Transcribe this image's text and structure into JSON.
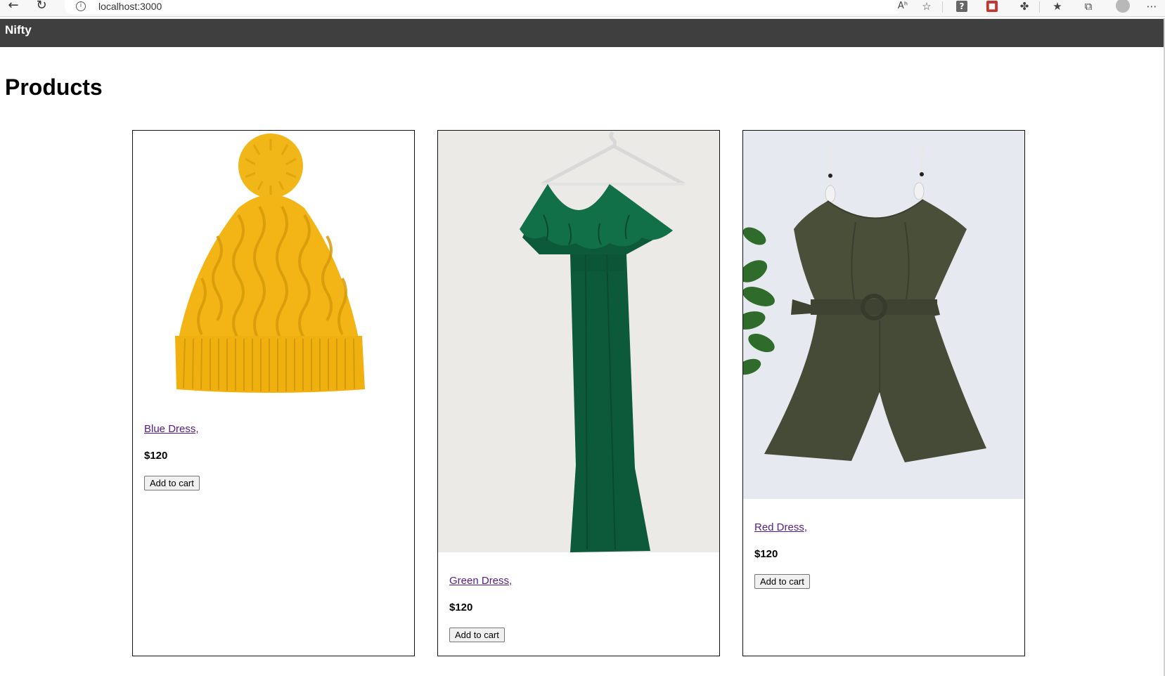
{
  "browser": {
    "url": "localhost:3000",
    "icons": {
      "back": "back-arrow-icon",
      "reload": "reload-icon",
      "info": "info-icon",
      "read_aloud": "read-aloud-icon",
      "favorite": "add-favorite-icon",
      "help": "help-extension-icon",
      "extension": "red-extension-icon",
      "extensions": "puzzle-icon",
      "favorites": "favorites-icon",
      "collections": "collections-icon",
      "profile": "profile-avatar-icon",
      "more": "more-menu-icon"
    },
    "reader_label": "Aʰ",
    "help_label": "?"
  },
  "app": {
    "brand": "Nifty",
    "nav_color": "#3f3f3f"
  },
  "page": {
    "title": "Products"
  },
  "products": [
    {
      "name": "Blue Dress,",
      "price": "$120",
      "button": "Add to cart",
      "image": "yellow-knit-beanie",
      "image_color": "#f2b515"
    },
    {
      "name": "Green Dress,",
      "price": "$120",
      "button": "Add to cart",
      "image": "green-maxi-dress",
      "image_color": "#0f5a3c"
    },
    {
      "name": "Red Dress,",
      "price": "$120",
      "button": "Add to cart",
      "image": "olive-romper",
      "image_color": "#454a36"
    }
  ]
}
